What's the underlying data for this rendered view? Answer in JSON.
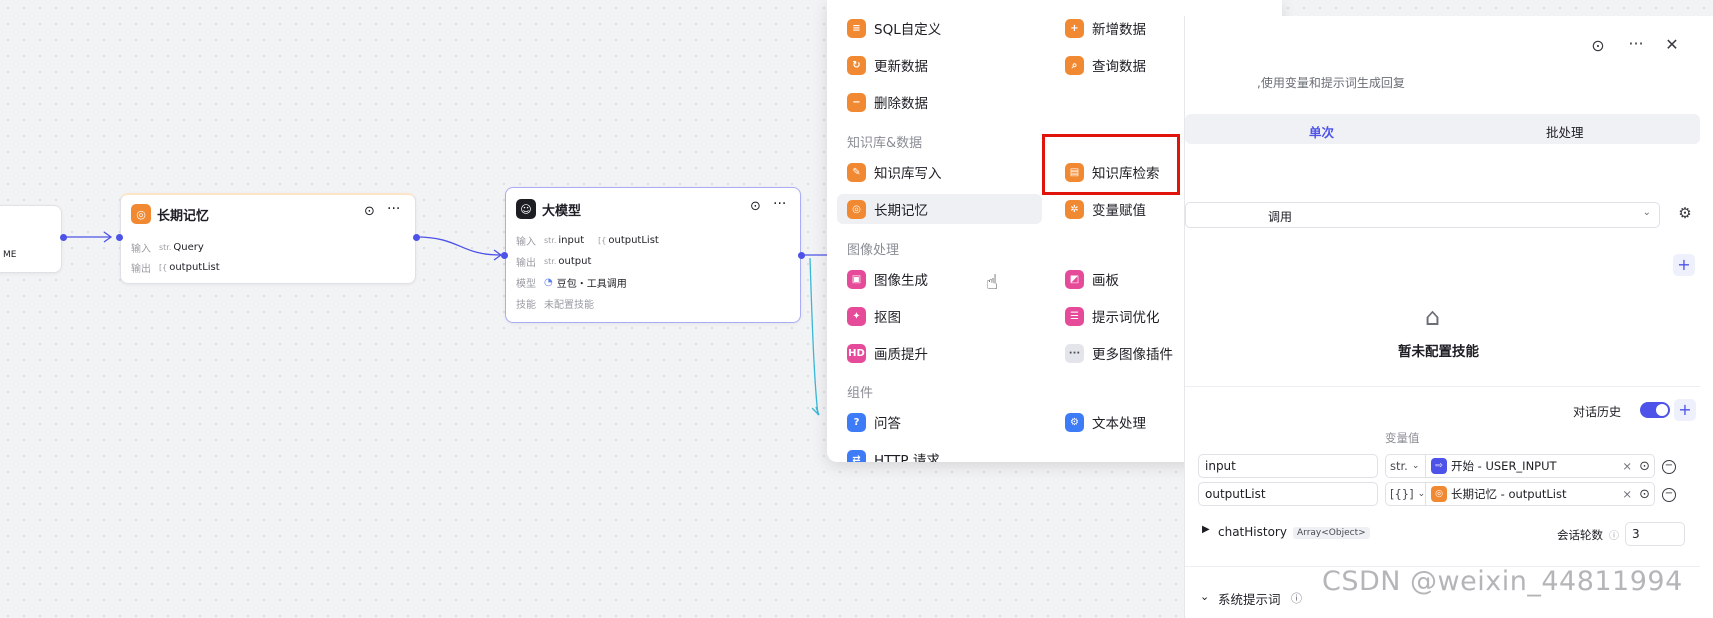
{
  "canvas": {
    "partial_node": {
      "text": "ME"
    },
    "memory_node": {
      "title": "长期记忆",
      "input_label": "输入",
      "input_type": "str.",
      "input_value": "Query",
      "output_label": "输出",
      "output_type": "[{",
      "output_value": "outputList"
    },
    "llm_node": {
      "title": "大模型",
      "input_label": "输入",
      "input_type_1": "str.",
      "input_value_1": "input",
      "input_type_2": "[{",
      "input_value_2": "outputList",
      "output_label": "输出",
      "output_type": "str.",
      "output_value": "output",
      "model_label": "模型",
      "model_value": "豆包・工具调用",
      "skill_label": "技能",
      "skill_value": "未配置技能"
    }
  },
  "picker": {
    "items": [
      {
        "label": "SQL自定义",
        "icon": "database-icon",
        "color": "#f18932"
      },
      {
        "label": "新增数据",
        "icon": "database-add-icon",
        "color": "#f18932"
      },
      {
        "label": "更新数据",
        "icon": "database-update-icon",
        "color": "#f18932"
      },
      {
        "label": "查询数据",
        "icon": "database-search-icon",
        "color": "#f18932"
      },
      {
        "label": "删除数据",
        "icon": "database-delete-icon",
        "color": "#f18932"
      },
      {
        "label": "知识库写入",
        "icon": "knowledge-write-icon",
        "color": "#f18932"
      },
      {
        "label": "知识库检索",
        "icon": "knowledge-search-icon",
        "color": "#f18932"
      },
      {
        "label": "长期记忆",
        "icon": "memory-icon",
        "color": "#f18932"
      },
      {
        "label": "变量赋值",
        "icon": "variable-icon",
        "color": "#f18932"
      },
      {
        "label": "图像生成",
        "icon": "image-gen-icon",
        "color": "#e64b9a"
      },
      {
        "label": "画板",
        "icon": "canvas-icon",
        "color": "#e64b9a"
      },
      {
        "label": "抠图",
        "icon": "cutout-icon",
        "color": "#e64b9a"
      },
      {
        "label": "提示词优化",
        "icon": "prompt-optimize-icon",
        "color": "#e64b9a"
      },
      {
        "label": "画质提升",
        "icon": "quality-icon",
        "color": "#e64b9a"
      },
      {
        "label": "更多图像插件",
        "icon": "more-icon",
        "color": "#e3e5ea"
      },
      {
        "label": "问答",
        "icon": "question-icon",
        "color": "#3e7bf6"
      },
      {
        "label": "文本处理",
        "icon": "text-process-icon",
        "color": "#3e7bf6"
      },
      {
        "label": "HTTP 请求",
        "icon": "http-icon",
        "color": "#3e7bf6"
      }
    ],
    "categories": {
      "knowledge": "知识库&数据",
      "image": "图像处理",
      "component": "组件"
    }
  },
  "panel": {
    "description": ",使用变量和提示词生成回复",
    "tab_single": "单次",
    "tab_batch": "批处理",
    "model_select": "调用",
    "skills_empty": "暂未配置技能",
    "chat_history_label": "对话历史",
    "var_value_header": "变量值",
    "inputs": [
      {
        "name": "input",
        "type": "str.",
        "ref_icon_color": "#4d53e8",
        "ref_text": "开始 - USER_INPUT"
      },
      {
        "name": "outputList",
        "type": "[{}]",
        "ref_icon_color": "#f18932",
        "ref_text": "长期记忆 - outputList"
      }
    ],
    "chat_history_var": "chatHistory",
    "chat_history_type": "Array<Object>",
    "rounds_label": "会话轮数",
    "rounds_value": "3",
    "system_prompt_label": "系统提示词"
  },
  "watermark": "CSDN @weixin_44811994"
}
